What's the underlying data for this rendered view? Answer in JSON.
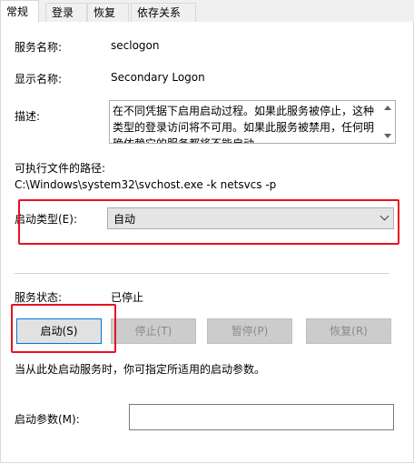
{
  "tabs": [
    {
      "label": "常规"
    },
    {
      "label": "登录"
    },
    {
      "label": "恢复"
    },
    {
      "label": "依存关系"
    }
  ],
  "general": {
    "service_name_label": "服务名称:",
    "service_name_value": "seclogon",
    "display_name_label": "显示名称:",
    "display_name_value": "Secondary Logon",
    "description_label": "描述:",
    "description_value": "在不同凭据下启用启动过程。如果此服务被停止，这种类型的登录访问将不可用。如果此服务被禁用，任何明确依赖它的服务都将不能启动。",
    "exe_path_label": "可执行文件的路径:",
    "exe_path_value": "C:\\Windows\\system32\\svchost.exe -k netsvcs -p",
    "startup_type_label": "启动类型(E):",
    "startup_type_value": "自动",
    "service_status_label": "服务状态:",
    "service_status_value": "已停止",
    "start_button": "启动(S)",
    "stop_button": "停止(T)",
    "pause_button": "暂停(P)",
    "resume_button": "恢复(R)",
    "hint_text": "当从此处启动服务时，你可指定所适用的启动参数。",
    "start_params_label": "启动参数(M):",
    "start_params_value": ""
  },
  "colors": {
    "highlight_red": "#e81123",
    "accent_blue": "#0078d7"
  }
}
